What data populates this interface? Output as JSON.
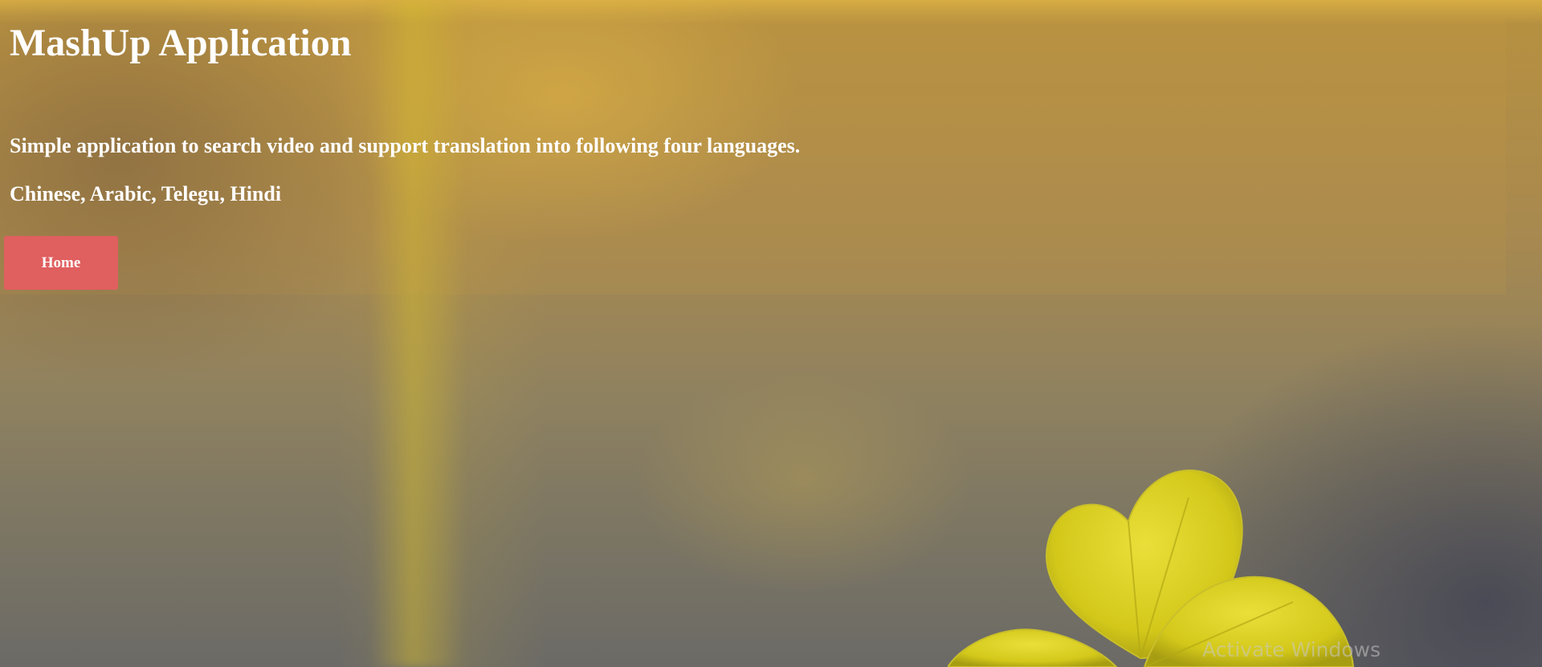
{
  "app": {
    "title": "MashUp Application",
    "description": "Simple application to search video and support translation into following four languages.",
    "languages": "Chinese, Arabic, Telegu, Hindi"
  },
  "actions": {
    "home_label": "Home"
  },
  "system": {
    "watermark": "Activate Windows"
  },
  "colors": {
    "button_bg": "#e05f5f",
    "text": "#ffffff",
    "leaf": "#d9d21c"
  },
  "icons": {
    "background_leaf": "clover-leaf-icon"
  }
}
